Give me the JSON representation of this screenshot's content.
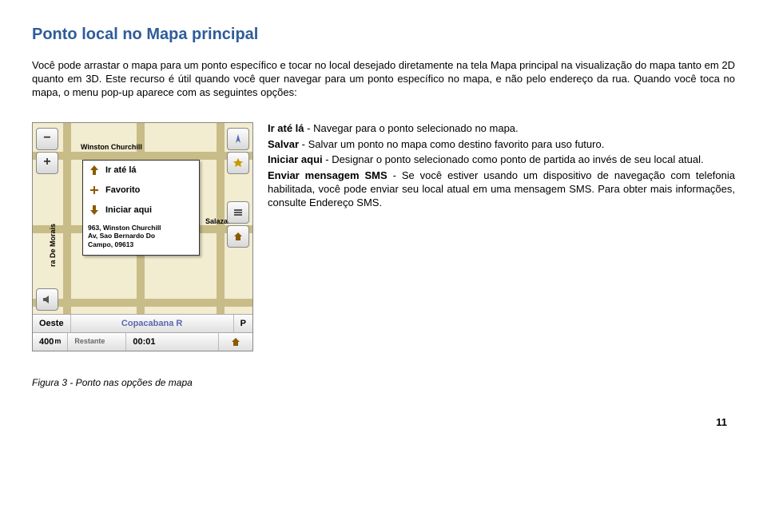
{
  "heading": "Ponto local no Mapa principal",
  "intro": {
    "p1": "Você pode arrastar o mapa para um ponto específico e tocar no local desejado diretamente na tela Mapa principal na visualização do mapa tanto em 2D quanto em 3D. Este recurso é útil quando você quer navegar para um ponto específico no mapa, e não pelo endereço da rua. Quando você toca no mapa, o menu pop-up aparece com as seguintes opções:"
  },
  "definitions": {
    "d1": {
      "term": "Ir até lá",
      "text": " - Navegar para o ponto selecionado no mapa."
    },
    "d2": {
      "term": "Salvar",
      "text": " - Salvar um ponto no mapa como destino favorito para uso futuro."
    },
    "d3": {
      "term": "Iniciar aqui",
      "text": " - Designar o ponto selecionado como ponto de partida ao invés de seu local atual."
    },
    "d4": {
      "term": "Enviar mensagem SMS",
      "text": " - Se você estiver usando um dispositivo de navegação com telefonia habilitada, você pode enviar seu local atual em uma mensagem SMS. Para obter mais informações, consulte Endereço SMS."
    }
  },
  "screenshot": {
    "roads": {
      "winston": "Winston Churchill",
      "salazar": "Salazar R",
      "morais": "ra De Morais",
      "copacabana": "Copacabana R"
    },
    "popup": {
      "go": "Ir até lá",
      "fav": "Favorito",
      "start": "Iniciar aqui",
      "addr1": "963, Winston Churchill",
      "addr2": "Av, Sao Bernardo Do",
      "addr3": "Campo, 09613"
    },
    "direction_bar": {
      "label": "Oeste",
      "road_suffix": "P"
    },
    "status_bar": {
      "dist": "400",
      "dist_unit": "m",
      "rest": "Restante",
      "time": "00:01"
    }
  },
  "figure_caption": "Figura 3 - Ponto nas opções de mapa",
  "page_number": "11"
}
